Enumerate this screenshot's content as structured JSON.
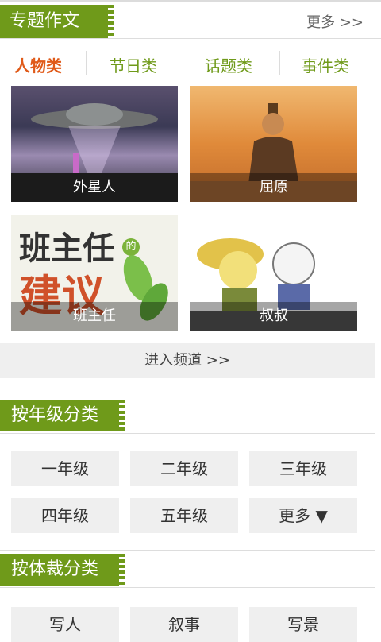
{
  "topic": {
    "title": "专题作文",
    "more": "更多 >>",
    "tabs": [
      "人物类",
      "节日类",
      "话题类",
      "事件类"
    ],
    "cards": [
      {
        "label": "外星人"
      },
      {
        "label": "屈原"
      },
      {
        "label": "班主任",
        "art_text_1": "班主任",
        "art_text_2": "建议",
        "art_text_3": "的"
      },
      {
        "label": "叔叔"
      }
    ],
    "enter": "进入频道 >>"
  },
  "grade": {
    "title": "按年级分类",
    "items": [
      "一年级",
      "二年级",
      "三年级",
      "四年级",
      "五年级",
      "更多 ▼"
    ]
  },
  "genre": {
    "title": "按体裁分类",
    "items": [
      "写人",
      "叙事",
      "写景"
    ]
  },
  "colors": {
    "accent": "#6f9a1a",
    "active_tab": "#e05a19"
  }
}
